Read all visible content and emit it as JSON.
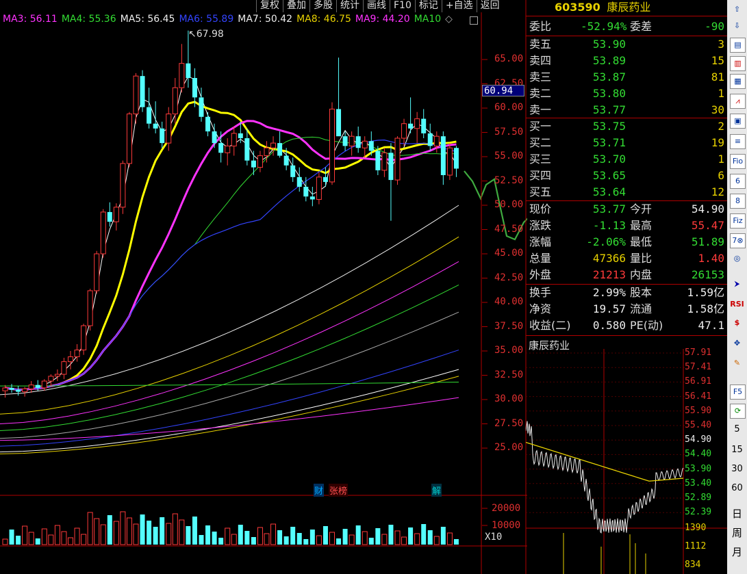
{
  "toolbar": [
    "复权",
    "叠加",
    "多股",
    "统计",
    "画线",
    "F10",
    "标记",
    "+自选",
    "返回"
  ],
  "ma_legend": [
    {
      "label": "MA3: 56.11",
      "color": "#ff33ff"
    },
    {
      "label": "MA4: 55.36",
      "color": "#33dd33"
    },
    {
      "label": "MA5: 56.45",
      "color": "#eeeeee"
    },
    {
      "label": "MA6: 55.89",
      "color": "#3344ff"
    },
    {
      "label": "MA7: 50.42",
      "color": "#eeeeee"
    },
    {
      "label": "MA8: 46.75",
      "color": "#e8d200"
    },
    {
      "label": "MA9: 44.20",
      "color": "#ff33ff"
    },
    {
      "label": "MA10",
      "color": "#33dd33"
    }
  ],
  "price_axis": [
    "65.00",
    "62.50",
    "60.00",
    "57.50",
    "55.00",
    "52.50",
    "50.00",
    "47.50",
    "45.00",
    "42.50",
    "40.00",
    "37.50",
    "35.00",
    "32.50",
    "30.00",
    "27.50",
    "25.00"
  ],
  "high_marker": "67.98",
  "cursor_price": "60.94",
  "volume_axis": [
    "20000",
    "10000"
  ],
  "volume_unit": "X10",
  "event_marks": [
    {
      "text": "财",
      "color": "#00aaff"
    },
    {
      "text": "张榜",
      "color": "#ff5050"
    },
    {
      "text": "解",
      "color": "#00cccc"
    }
  ],
  "stock": {
    "code": "603590",
    "name": "康辰药业"
  },
  "weibi": {
    "label": "委比",
    "value": "-52.94%",
    "label2": "委差",
    "value2": "-90"
  },
  "asks": [
    {
      "label": "卖五",
      "price": "53.90",
      "vol": "3"
    },
    {
      "label": "卖四",
      "price": "53.89",
      "vol": "15"
    },
    {
      "label": "卖三",
      "price": "53.87",
      "vol": "81"
    },
    {
      "label": "卖二",
      "price": "53.80",
      "vol": "1"
    },
    {
      "label": "卖一",
      "price": "53.77",
      "vol": "30"
    }
  ],
  "bids": [
    {
      "label": "买一",
      "price": "53.75",
      "vol": "2"
    },
    {
      "label": "买二",
      "price": "53.71",
      "vol": "19"
    },
    {
      "label": "买三",
      "price": "53.70",
      "vol": "1"
    },
    {
      "label": "买四",
      "price": "53.65",
      "vol": "6"
    },
    {
      "label": "买五",
      "price": "53.64",
      "vol": "12"
    }
  ],
  "quote": [
    {
      "k": "现价",
      "v": "53.77",
      "vc": "g",
      "k2": "今开",
      "v2": "54.90",
      "v2c": "w"
    },
    {
      "k": "涨跌",
      "v": "-1.13",
      "vc": "g",
      "k2": "最高",
      "v2": "55.47",
      "v2c": "r"
    },
    {
      "k": "涨幅",
      "v": "-2.06%",
      "vc": "g",
      "k2": "最低",
      "v2": "51.89",
      "v2c": "g"
    },
    {
      "k": "总量",
      "v": "47366",
      "vc": "y",
      "k2": "量比",
      "v2": "1.40",
      "v2c": "r"
    },
    {
      "k": "外盘",
      "v": "21213",
      "vc": "r",
      "k2": "内盘",
      "v2": "26153",
      "v2c": "g"
    }
  ],
  "finance": [
    {
      "k": "换手",
      "v": "2.99%",
      "k2": "股本",
      "v2": "1.59亿"
    },
    {
      "k": "净资",
      "v": "19.57",
      "k2": "流通",
      "v2": "1.58亿"
    },
    {
      "k": "收益(二)",
      "v": "0.580",
      "k2": "PE(动)",
      "v2": "47.1"
    }
  ],
  "mini_title": "康辰药业",
  "mini_axis": [
    "57.91",
    "57.41",
    "56.91",
    "56.41",
    "55.90",
    "55.40",
    "54.90",
    "54.40",
    "53.90",
    "53.40",
    "52.89",
    "52.39"
  ],
  "mini_vol_axis": [
    "1390",
    "1112",
    "834"
  ],
  "sidebar_text": [
    "5",
    "15",
    "30",
    "60",
    "日",
    "周",
    "月"
  ]
}
